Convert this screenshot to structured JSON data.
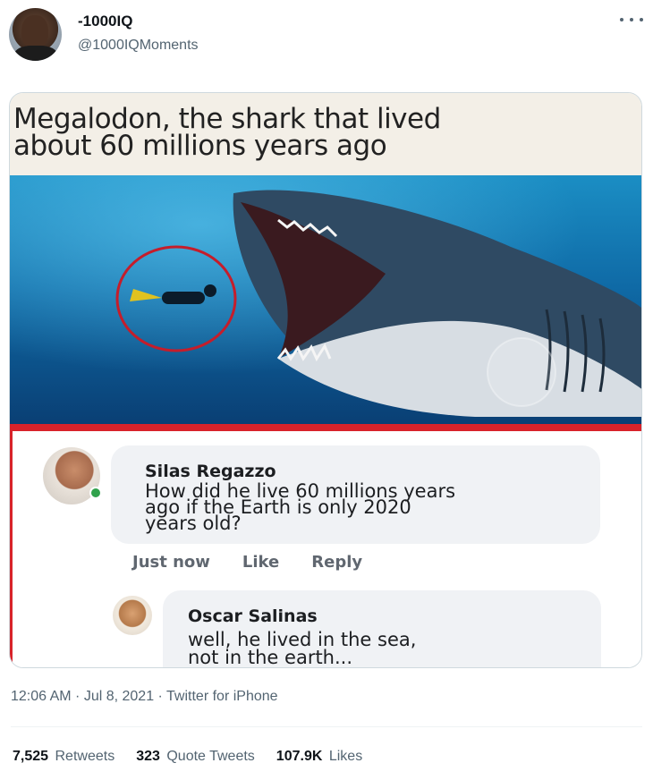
{
  "tweet": {
    "author": {
      "display_name": "-1000IQ",
      "handle": "@1000IQMoments",
      "avatar_icon": "profile-photo"
    },
    "more_icon": "more-dots-icon",
    "meta": {
      "timestamp": "12:06 AM · Jul 8, 2021 · Twitter for iPhone"
    },
    "stats": {
      "retweets_count": "7,525",
      "retweets_label": "Retweets",
      "quote_count": "323",
      "quote_label": "Quote Tweets",
      "likes_count": "107.9K",
      "likes_label": "Likes"
    }
  },
  "meme": {
    "caption_line1": "Megalodon, the shark that lived",
    "caption_line2": "about 60 millions years ago",
    "comment1": {
      "name": "Silas Regazzo",
      "line1": "How did he live 60 millions years",
      "line2": "ago if the Earth is only 2020",
      "line3": "years old?",
      "time": "Just now",
      "like": "Like",
      "reply": "Reply"
    },
    "comment2": {
      "name": "Oscar Salinas",
      "line1": "well, he lived in the sea,",
      "line2": "not in the earth..."
    }
  },
  "colors": {
    "accent_red": "#d8232a",
    "secondary_text": "#536471",
    "online_green": "#31a24c"
  }
}
